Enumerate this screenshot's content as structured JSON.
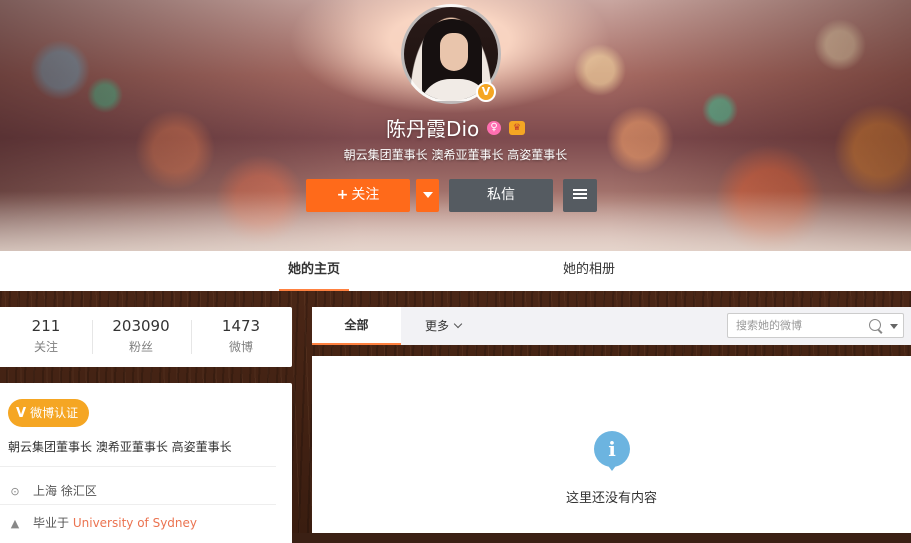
{
  "profile": {
    "name": "陈丹霞Dio",
    "bio": "朝云集团董事长 澳希亚董事长 高姿董事长",
    "verified_mark": "V",
    "gender_icon": "female-icon",
    "vip_icon": "vip-crown-icon"
  },
  "actions": {
    "follow_label": "关注",
    "follow_plus": "+",
    "message_label": "私信"
  },
  "tabs": [
    {
      "label": "她的主页",
      "active": true
    },
    {
      "label": "她的相册",
      "active": false
    }
  ],
  "stats": [
    {
      "value": "211",
      "label": "关注"
    },
    {
      "value": "203090",
      "label": "粉丝"
    },
    {
      "value": "1473",
      "label": "微博"
    }
  ],
  "info": {
    "cert_mark": "V",
    "cert_label": "微博认证",
    "title": "朝云集团董事长 澳希亚董事长 高姿董事长",
    "location": "上海 徐汇区",
    "edu_prefix": "毕业于",
    "edu_school": "University of Sydney"
  },
  "feed": {
    "tab_all": "全部",
    "tab_more": "更多",
    "search_placeholder": "搜索她的微博",
    "empty_mark": "i",
    "empty_text": "这里还没有内容"
  },
  "colors": {
    "accent_orange": "#ff6a1a",
    "tab_underline": "#ff8140",
    "dark_button": "#555b61",
    "verified_gold": "#f5a623",
    "link": "#eb7350",
    "info_blue": "#6cb4e0"
  }
}
